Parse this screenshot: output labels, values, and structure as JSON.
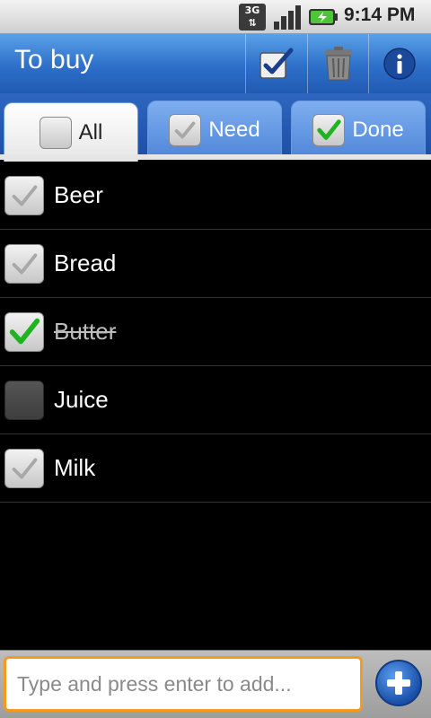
{
  "status_bar": {
    "network": "3G",
    "time": "9:14 PM",
    "icons": [
      "network-3g-icon",
      "signal-icon",
      "battery-charging-icon"
    ]
  },
  "title_bar": {
    "title": "To buy",
    "actions": [
      "check-all-icon",
      "trash-icon",
      "info-icon"
    ]
  },
  "tabs": [
    {
      "label": "All",
      "state": "empty",
      "active": true
    },
    {
      "label": "Need",
      "state": "gray",
      "active": false
    },
    {
      "label": "Done",
      "state": "green",
      "active": false
    }
  ],
  "items": [
    {
      "label": "Beer",
      "state": "gray"
    },
    {
      "label": "Bread",
      "state": "gray"
    },
    {
      "label": "Butter",
      "state": "green"
    },
    {
      "label": "Juice",
      "state": "empty"
    },
    {
      "label": "Milk",
      "state": "gray"
    }
  ],
  "input": {
    "placeholder": "Type and press enter to add...",
    "value": ""
  },
  "colors": {
    "accent": "#2d6fc9",
    "input_border": "#f39a22",
    "check_green": "#1fb31f"
  }
}
